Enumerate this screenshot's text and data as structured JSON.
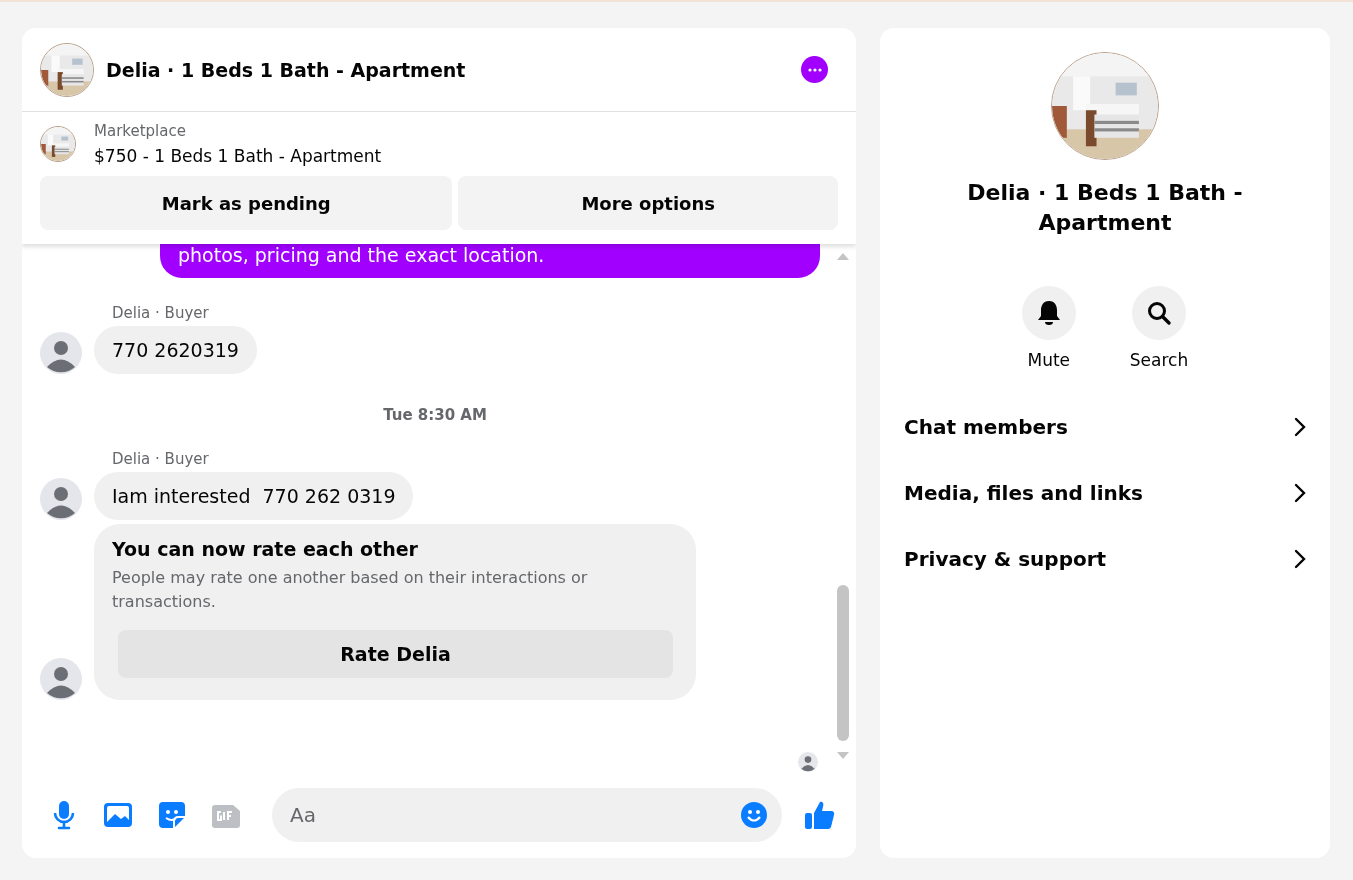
{
  "conversation": {
    "title": "Delia · 1 Beds 1 Bath - Apartment"
  },
  "listing": {
    "source": "Marketplace",
    "title": "$750 - 1 Beds 1 Bath - Apartment",
    "buttons": [
      "Mark as pending",
      "More options"
    ]
  },
  "messages": [
    {
      "kind": "outgoing",
      "text": "photos, pricing and the exact location."
    },
    {
      "kind": "incoming",
      "sender": "Delia · Buyer",
      "text": "770 2620319"
    },
    {
      "kind": "timestamp",
      "text": "Tue 8:30 AM"
    },
    {
      "kind": "incoming",
      "sender": "Delia · Buyer",
      "text": "Iam interested  770 262 0319"
    },
    {
      "kind": "rating_card",
      "title": "You can now rate each other",
      "body": "People may rate one another based on their interactions or transactions.",
      "button": "Rate Delia"
    }
  ],
  "composer": {
    "placeholder": "Aa"
  },
  "info": {
    "title": "Delia · 1 Beds 1 Bath - Apartment",
    "actions": [
      {
        "kind": "mute",
        "label": "Mute"
      },
      {
        "kind": "search",
        "label": "Search"
      }
    ],
    "rows": [
      "Chat members",
      "Media, files and links",
      "Privacy & support"
    ]
  }
}
